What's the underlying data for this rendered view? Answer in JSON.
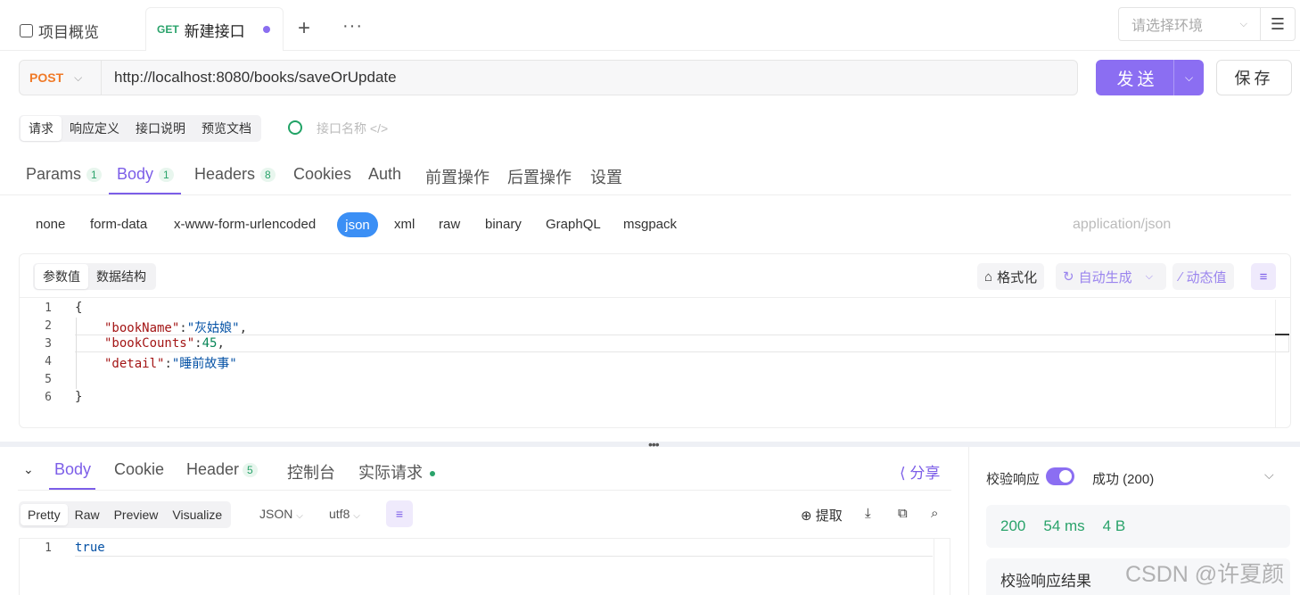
{
  "tabs": {
    "overview": "项目概览",
    "active_method": "GET",
    "active_title": "新建接口",
    "add": "+",
    "more": "···"
  },
  "env": {
    "placeholder": "请选择环境"
  },
  "request": {
    "method": "POST",
    "url": "http://localhost:8080/books/saveOrUpdate",
    "send": "发送",
    "save": "保存"
  },
  "modes": [
    "请求",
    "响应定义",
    "接口说明",
    "预览文档"
  ],
  "interface_name_placeholder": "接口名称",
  "req_tabs": {
    "params": "Params",
    "params_count": "1",
    "body": "Body",
    "body_count": "1",
    "headers": "Headers",
    "headers_count": "8",
    "cookies": "Cookies",
    "auth": "Auth",
    "pre": "前置操作",
    "post": "后置操作",
    "settings": "设置"
  },
  "body_types": [
    "none",
    "form-data",
    "x-www-form-urlencoded",
    "json",
    "xml",
    "raw",
    "binary",
    "GraphQL",
    "msgpack"
  ],
  "content_type": "application/json",
  "editor": {
    "seg": [
      "参数值",
      "数据结构"
    ],
    "format": "格式化",
    "autogen": "自动生成",
    "dynamic": "动态值",
    "line_numbers": [
      "1",
      "2",
      "3",
      "4",
      "5",
      "6"
    ],
    "lines": {
      "l1": "{",
      "k2": "\"bookName\"",
      "v2": "\"灰姑娘\"",
      "k3": "\"bookCounts\"",
      "v3": "45",
      "k4": "\"detail\"",
      "v4": "\"睡前故事\"",
      "l6": "}"
    }
  },
  "response": {
    "tabs": {
      "body": "Body",
      "cookie": "Cookie",
      "header": "Header",
      "header_count": "5",
      "console": "控制台",
      "actual": "实际请求"
    },
    "share": "分享",
    "views": [
      "Pretty",
      "Raw",
      "Preview",
      "Visualize"
    ],
    "format": "JSON",
    "encoding": "utf8",
    "extract": "提取",
    "line": "1",
    "value": "true"
  },
  "validation": {
    "label": "校验响应",
    "status": "成功 (200)",
    "code": "200",
    "time": "54 ms",
    "size": "4 B",
    "result": "校验响应结果"
  },
  "watermark": "CSDN @许夏颜",
  "colors": {
    "accent": "#8b6ef2",
    "method_post": "#f07a28",
    "method_get": "#2aa36b",
    "json_pill": "#3b8ff5",
    "success": "#2aa36b"
  }
}
